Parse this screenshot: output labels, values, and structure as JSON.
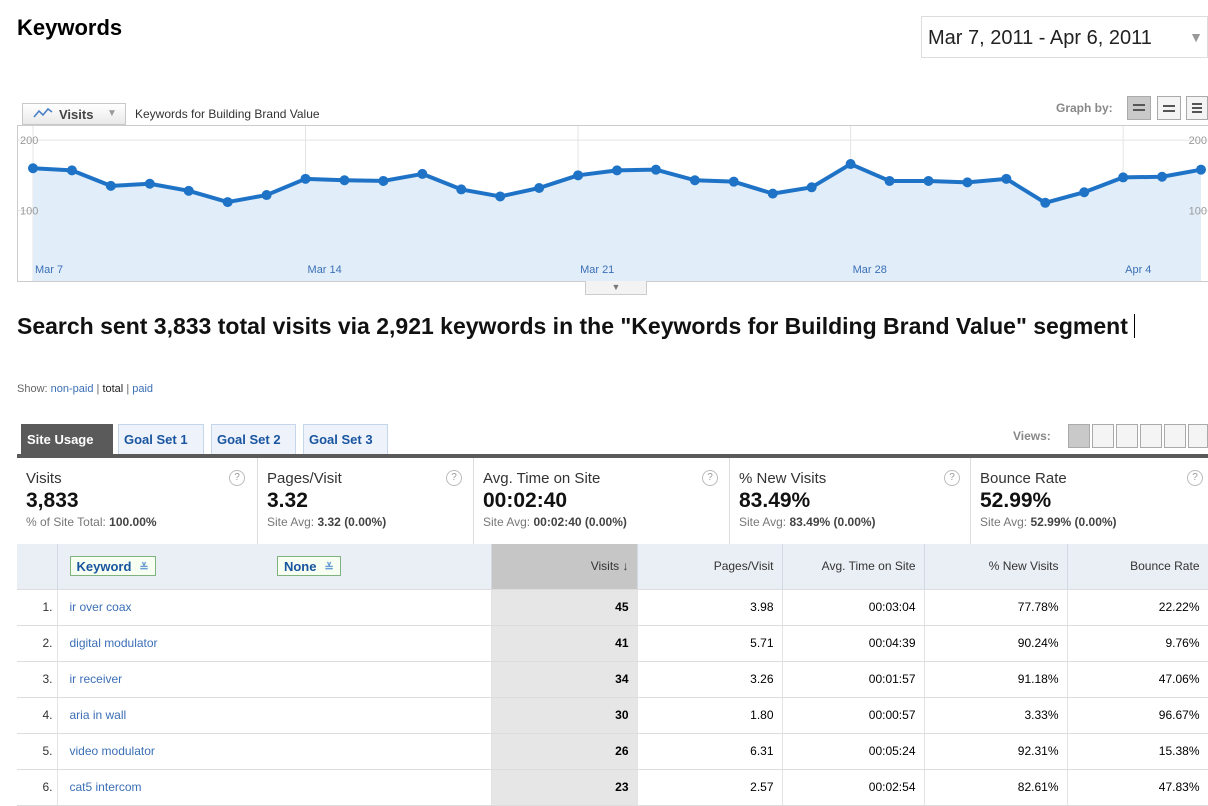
{
  "page": {
    "title": "Keywords",
    "date_range": "Mar 7, 2011 - Apr 6, 2011"
  },
  "graph": {
    "metric": "Visits",
    "segment": "Keywords for Building Brand Value",
    "graph_by_label": "Graph by:",
    "y_ticks": [
      "200",
      "100"
    ],
    "y_ticks_right": [
      "200",
      "100"
    ],
    "x_ticks": [
      "Mar 7",
      "Mar 14",
      "Mar 21",
      "Mar 28",
      "Apr 4"
    ],
    "values": [
      160,
      157,
      135,
      138,
      128,
      112,
      122,
      145,
      143,
      142,
      152,
      130,
      120,
      132,
      150,
      157,
      158,
      143,
      141,
      124,
      133,
      166,
      142,
      142,
      140,
      145,
      111,
      126,
      147,
      148,
      158
    ],
    "ylim": [
      0,
      220
    ],
    "color": "#1f73c7",
    "fill": "#e1eef9"
  },
  "headline": "Search sent 3,833 total visits via 2,921 keywords in the \"Keywords for Building Brand Value\" segment",
  "show": {
    "label": "Show:",
    "nonpaid": "non-paid",
    "sep1": "|",
    "total": "total",
    "sep2": "|",
    "paid": "paid"
  },
  "tabs": [
    "Site Usage",
    "Goal Set 1",
    "Goal Set 2",
    "Goal Set 3"
  ],
  "views_label": "Views:",
  "scorecard": [
    {
      "name": "Visits",
      "value": "3,833",
      "avg_label": "% of Site Total:",
      "avg_value": "100.00%"
    },
    {
      "name": "Pages/Visit",
      "value": "3.32",
      "avg_label": "Site Avg:",
      "avg_value": "3.32 (0.00%)"
    },
    {
      "name": "Avg. Time on Site",
      "value": "00:02:40",
      "avg_label": "Site Avg:",
      "avg_value": "00:02:40 (0.00%)"
    },
    {
      "name": "% New Visits",
      "value": "83.49%",
      "avg_label": "Site Avg:",
      "avg_value": "83.49% (0.00%)"
    },
    {
      "name": "Bounce Rate",
      "value": "52.99%",
      "avg_label": "Site Avg:",
      "avg_value": "52.99% (0.00%)"
    }
  ],
  "table": {
    "dim1": "Keyword",
    "dim2": "None",
    "headers": [
      "Visits",
      "Pages/Visit",
      "Avg. Time on Site",
      "% New Visits",
      "Bounce Rate"
    ],
    "rows": [
      {
        "rank": "1.",
        "keyword": "ir over coax",
        "visits": "45",
        "ppv": "3.98",
        "time": "00:03:04",
        "new": "77.78%",
        "bounce": "22.22%"
      },
      {
        "rank": "2.",
        "keyword": "digital modulator",
        "visits": "41",
        "ppv": "5.71",
        "time": "00:04:39",
        "new": "90.24%",
        "bounce": "9.76%"
      },
      {
        "rank": "3.",
        "keyword": "ir receiver",
        "visits": "34",
        "ppv": "3.26",
        "time": "00:01:57",
        "new": "91.18%",
        "bounce": "47.06%"
      },
      {
        "rank": "4.",
        "keyword": "aria in wall",
        "visits": "30",
        "ppv": "1.80",
        "time": "00:00:57",
        "new": "3.33%",
        "bounce": "96.67%"
      },
      {
        "rank": "5.",
        "keyword": "video modulator",
        "visits": "26",
        "ppv": "6.31",
        "time": "00:05:24",
        "new": "92.31%",
        "bounce": "15.38%"
      },
      {
        "rank": "6.",
        "keyword": "cat5 intercom",
        "visits": "23",
        "ppv": "2.57",
        "time": "00:02:54",
        "new": "82.61%",
        "bounce": "47.83%"
      }
    ]
  }
}
